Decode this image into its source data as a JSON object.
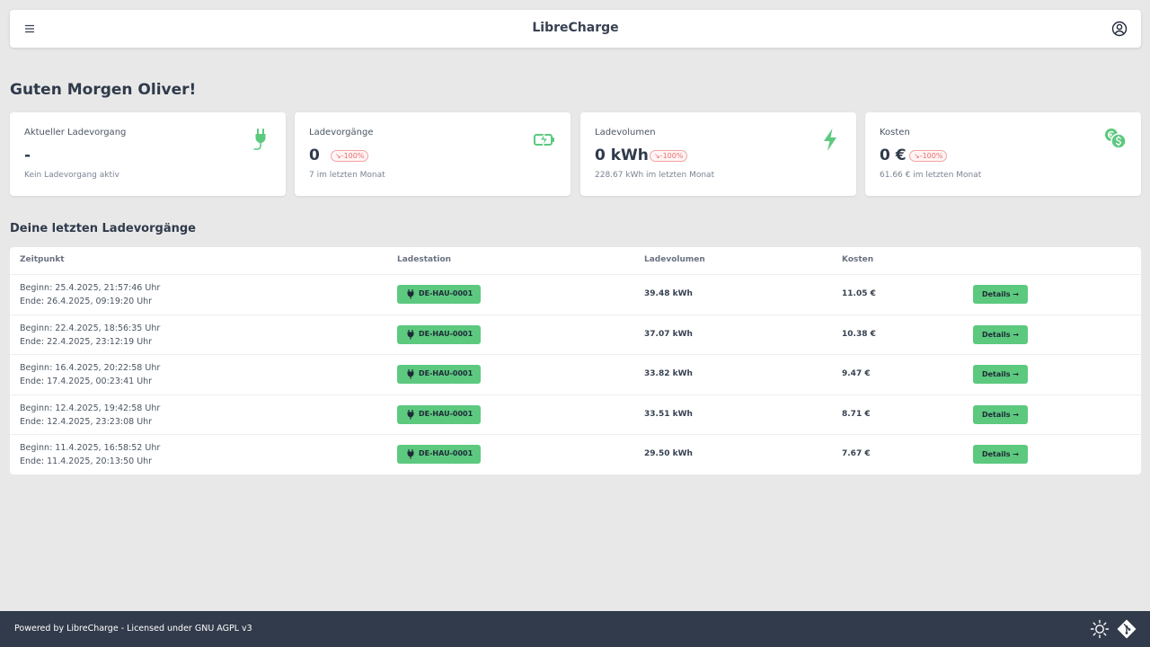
{
  "header": {
    "app_title": "LibreCharge"
  },
  "greeting": "Guten Morgen Oliver!",
  "cards": [
    {
      "title": "Aktueller Ladevorgang",
      "value": "-",
      "badge": "",
      "sub": "Kein Ladevorgang aktiv",
      "icon": "plug-icon"
    },
    {
      "title": "Ladevorgänge",
      "value": "0",
      "badge": "↘-100%",
      "sub": "7 im letzten Monat",
      "icon": "battery-charging-icon"
    },
    {
      "title": "Ladevolumen",
      "value": "0 kWh",
      "badge": "↘-100%",
      "sub": "228.67 kWh im letzten Monat",
      "icon": "bolt-icon"
    },
    {
      "title": "Kosten",
      "value": "0 €",
      "badge": "↘-100%",
      "sub": "61.66 € im letzten Monat",
      "icon": "coins-icon"
    }
  ],
  "sessions": {
    "title": "Deine letzten Ladevorgänge",
    "columns": [
      "Zeitpunkt",
      "Ladestation",
      "Ladevolumen",
      "Kosten"
    ],
    "details_label": "Details →",
    "rows": [
      {
        "begin": "Beginn: 25.4.2025, 21:57:46 Uhr",
        "end": "Ende: 26.4.2025, 09:19:20 Uhr",
        "station": "DE-HAU-0001",
        "volume": "39.48 kWh",
        "cost": "11.05 €"
      },
      {
        "begin": "Beginn: 22.4.2025, 18:56:35 Uhr",
        "end": "Ende: 22.4.2025, 23:12:19 Uhr",
        "station": "DE-HAU-0001",
        "volume": "37.07 kWh",
        "cost": "10.38 €"
      },
      {
        "begin": "Beginn: 16.4.2025, 20:22:58 Uhr",
        "end": "Ende: 17.4.2025, 00:23:41 Uhr",
        "station": "DE-HAU-0001",
        "volume": "33.82 kWh",
        "cost": "9.47 €"
      },
      {
        "begin": "Beginn: 12.4.2025, 19:42:58 Uhr",
        "end": "Ende: 12.4.2025, 23:23:08 Uhr",
        "station": "DE-HAU-0001",
        "volume": "33.51 kWh",
        "cost": "8.71 €"
      },
      {
        "begin": "Beginn: 11.4.2025, 16:58:52 Uhr",
        "end": "Ende: 11.4.2025, 20:13:50 Uhr",
        "station": "DE-HAU-0001",
        "volume": "29.50 kWh",
        "cost": "7.67 €"
      }
    ]
  },
  "footer": {
    "text": "Powered by LibreCharge - Licensed under GNU AGPL v3"
  },
  "colors": {
    "accent": "#5cc97f",
    "footer_bg": "#323b4b",
    "negative": "#ef6b6b",
    "background": "#e8e8e8"
  }
}
